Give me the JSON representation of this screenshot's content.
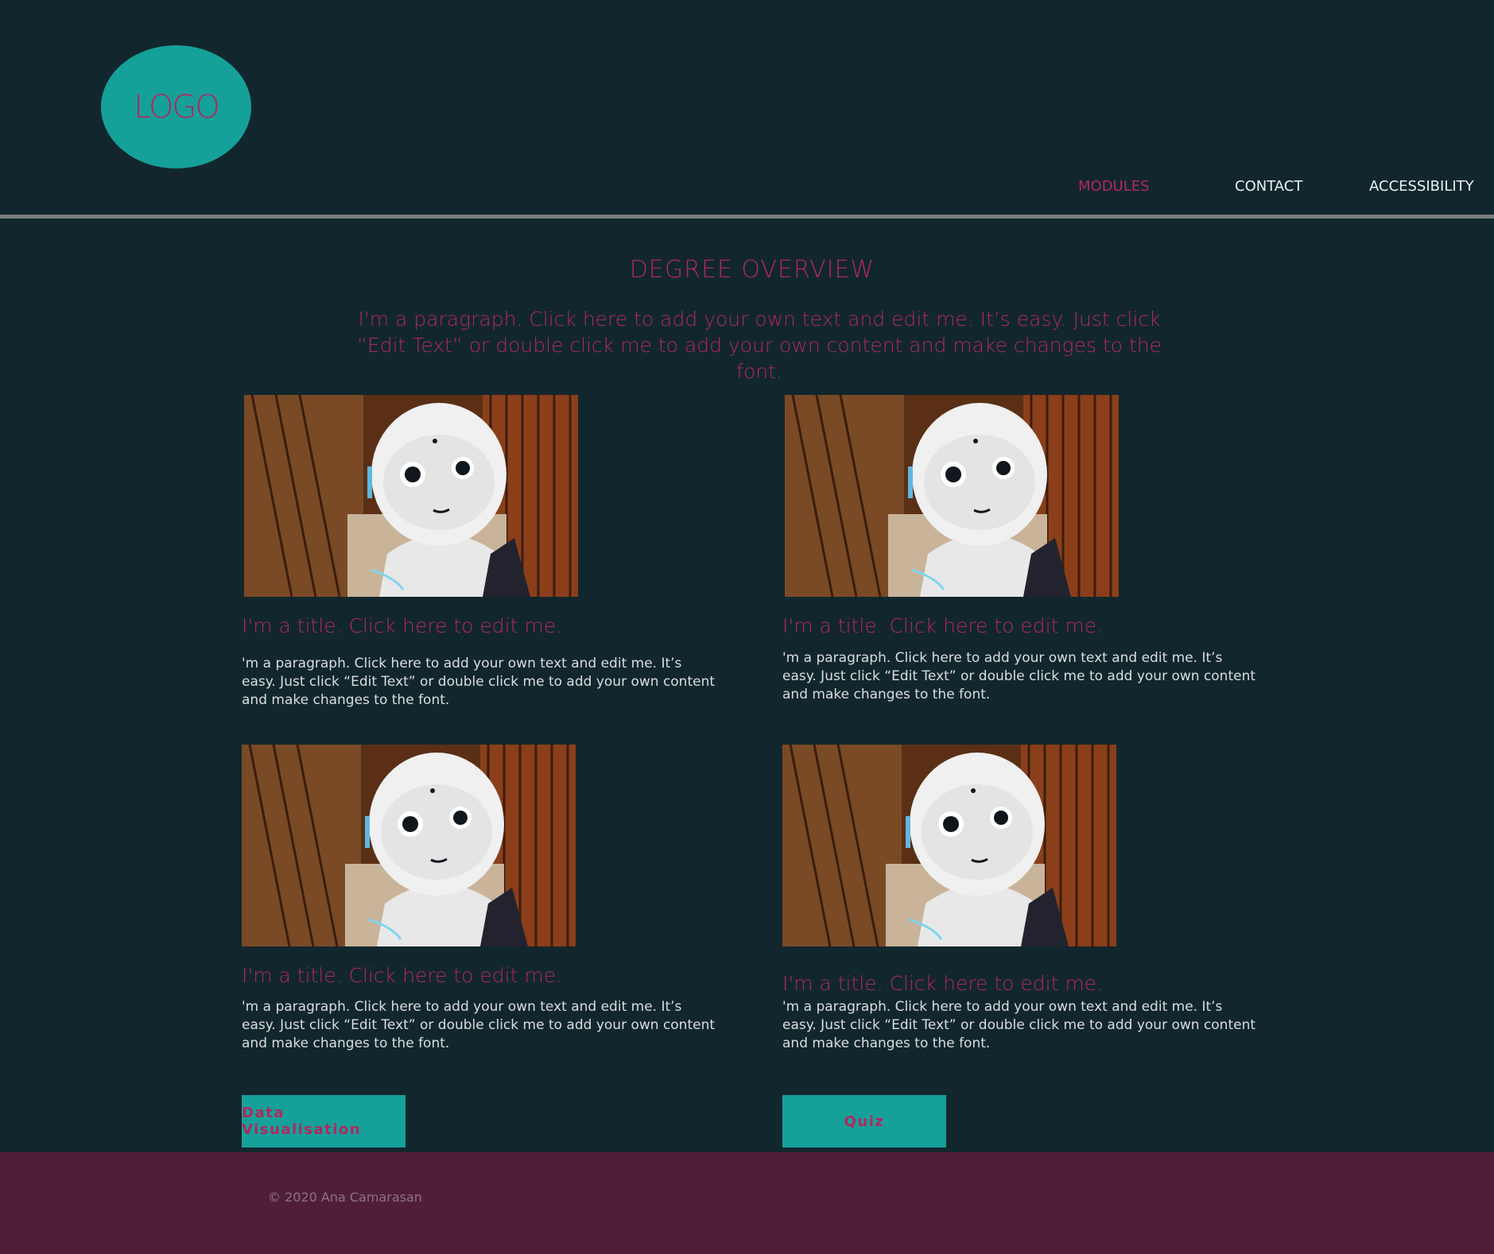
{
  "header": {
    "logo_text": "LOGO",
    "nav": [
      {
        "label": "MODULES",
        "active": true
      },
      {
        "label": "CONTACT",
        "active": false
      },
      {
        "label": "ACCESSIBILITY",
        "active": false
      }
    ]
  },
  "main": {
    "title": "DEGREE OVERVIEW",
    "intro": "I'm a paragraph. Click here to add your own text and edit me. It’s easy. Just click “Edit Text” or double click me to add your own content and make changes to the font.",
    "cards": [
      {
        "title": "I'm a title. Click here to edit me.",
        "text": "'m a paragraph. Click here to add your own text and edit me. It’s easy. Just click “Edit Text” or double click me to add your own content and make changes to the font.",
        "image": "robot-photo"
      },
      {
        "title": "I'm a title. Click here to edit me.",
        "text": "'m a paragraph. Click here to add your own text and edit me. It’s easy. Just click “Edit Text” or double click me to add your own content and make changes to the font.",
        "image": "robot-photo"
      },
      {
        "title": "I'm a title. Click here to edit me.",
        "text": "'m a paragraph. Click here to add your own text and edit me. It’s easy. Just click “Edit Text” or double click me to add your own content and make changes to the font.",
        "image": "robot-photo"
      },
      {
        "title": "I'm a title. Click here to edit me.",
        "text": "'m a paragraph. Click here to add your own text and edit me. It’s easy. Just click “Edit Text” or double click me to add your own content and make changes to the font.",
        "image": "robot-photo"
      }
    ],
    "buttons": [
      {
        "label": "Data Visualisation"
      },
      {
        "label": "Quiz"
      }
    ]
  },
  "footer": {
    "copyright": "© 2020 Ana Camarasan"
  },
  "colors": {
    "background": "#12272d",
    "accent": "#b0285f",
    "teal": "#16a09a",
    "footer": "#511e38"
  }
}
